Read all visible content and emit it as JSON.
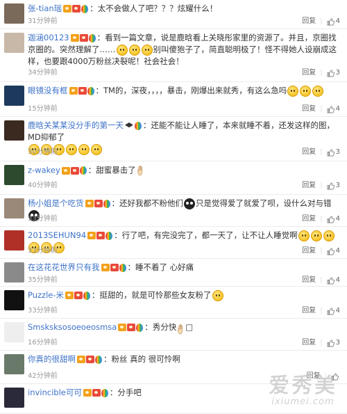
{
  "comments": [
    {
      "username": "张-tian瑶",
      "text": "：太不会做人了吧？？？炫耀什么！",
      "emojis_after": 0,
      "time": "31分钟前",
      "likes": "4",
      "reply_label": "回复",
      "avatar_color": "#7a6a5a"
    },
    {
      "username": "迦涵00123",
      "text": "：看到一篇文章，说是鹿晗看上关晓彤家里的资源了。并且，京圈找京圈的。突然理解了……",
      "text_cont": "别叫傻狍子了，简直聪明极了！怪不得她人设崩成这样，也要跟4000万粉丝决裂呢！社会社会！",
      "emojis_mid": 3,
      "time": "34分钟前",
      "likes": "3",
      "reply_label": "回复",
      "avatar_color": "#c8b8a8"
    },
    {
      "username": "眼镜没有框",
      "text": "：TM的，深夜，，，，暴击，刚爆出来就秀，有这么急吗",
      "emojis_after": 3,
      "time": "15分钟前",
      "likes": "4",
      "reply_label": "回复",
      "avatar_color": "#1d3a5c"
    },
    {
      "username": "鹿晗关某某没分手的第一天",
      "text": "：还能不能让人睡了，本来就睡不着，还发这样的图，MD抑郁了",
      "emojis_next_line": 6,
      "time": "30分钟前",
      "likes": "3",
      "reply_label": "回复",
      "avatar_color": "#3a2a20"
    },
    {
      "username": "z-wakey",
      "text": "：甜蜜暴击了",
      "hand": true,
      "time": "40分钟前",
      "likes": "3",
      "reply_label": "回复",
      "avatar_color": "#2e4a2e"
    },
    {
      "username": "杨小姐是个吃货",
      "text": "：还好我都不粉他们",
      "text_cont": "只是觉得爱了就爱了呗，设什么对与错",
      "time": "33分钟前",
      "likes": "4",
      "reply_label": "回复",
      "avatar_color": "#9a8878"
    },
    {
      "username": "2013SEHUN94",
      "text": "：行了吧，有完没完了，都一天了，让不让人睡觉啊",
      "emojis_after": 6,
      "time": "33分钟前",
      "likes": "4",
      "reply_label": "回复",
      "avatar_color": "#b03028"
    },
    {
      "username": "在这花花世界只有我",
      "text": "：睡不着了 心好痛",
      "time": "35分钟前",
      "likes": "4",
      "reply_label": "回复",
      "avatar_color": "#8a8a8a"
    },
    {
      "username": "Puzzle-米",
      "text": "：挺甜的，就是可怜那些女友粉了",
      "emojis_after": 1,
      "time": "33分钟前",
      "likes": "4",
      "reply_label": "回复",
      "avatar_color": "#111111"
    },
    {
      "username": "Smsksksosoeoeosmsa",
      "text": "：秀分快",
      "hand_small": true,
      "tail": "□",
      "time": "16分钟前",
      "likes": "3",
      "reply_label": "回复",
      "avatar_color": "#eeeeee"
    },
    {
      "username": "你真的很甜啊",
      "text": "：粉丝 真的 很可怜啊",
      "time": "42分钟前",
      "likes": "",
      "reply_label": "回复",
      "avatar_color": "#6a7a6a"
    },
    {
      "username": "invincible可可",
      "text": "：分手吧",
      "time": "",
      "likes": "",
      "reply_label": "",
      "avatar_color": "#2a2a3a"
    }
  ],
  "watermark": {
    "big": "爱秀美",
    "small": "ixiumei.com"
  },
  "colors": {
    "username": "#3d72c7",
    "text": "#333333",
    "meta": "#999999"
  }
}
